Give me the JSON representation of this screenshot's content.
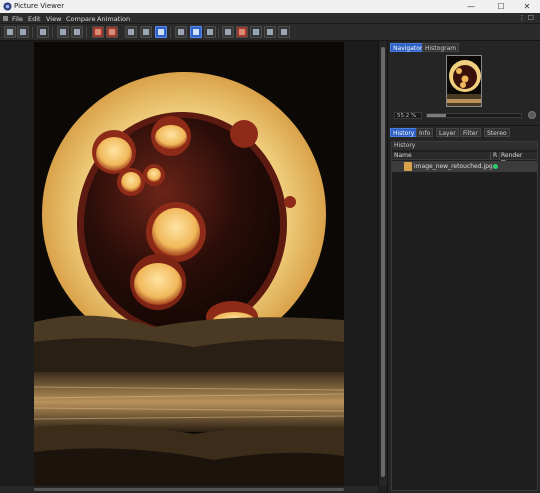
{
  "window": {
    "title": "Picture Viewer",
    "controls": [
      "—",
      "☐",
      "✕"
    ]
  },
  "menu": {
    "items": [
      "File",
      "Edit",
      "View",
      "Compare",
      "Animation"
    ]
  },
  "navigator": {
    "tabs": [
      "Navigator",
      "Histogram"
    ],
    "active_tab": "Navigator",
    "zoom_value": "55.2 %",
    "zoom_fraction": 0.2
  },
  "info_tabs": {
    "tabs": [
      "History",
      "Info",
      "Layer",
      "Filter",
      "Stereo"
    ],
    "active_tab": "History"
  },
  "history": {
    "title": "History",
    "columns": [
      "Name",
      "R",
      "Render Time"
    ],
    "rows": [
      {
        "name": "image_new_retouched.jpg",
        "status_color": "#2ecc71"
      }
    ]
  },
  "colors": {
    "accent": "#2d5fc4",
    "toolbar_active": "#2f63c7",
    "toolbar_red": "#a0362a",
    "moon": "#f2d48a"
  }
}
